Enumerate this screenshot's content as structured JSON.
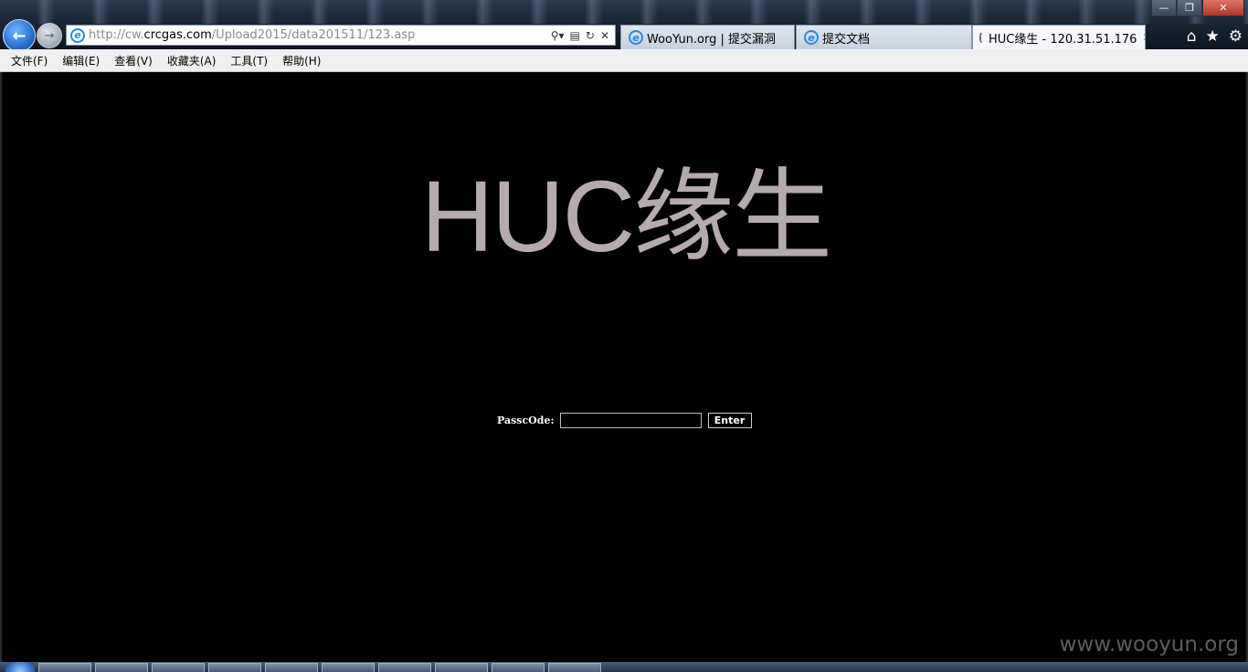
{
  "browser": {
    "address_url_prefix": "http://cw.",
    "address_url_domain": "crcgas.com",
    "address_url_path": "/Upload2015/data201511/123.asp",
    "tabs": [
      {
        "label": "WooYun.org | 提交漏洞",
        "icon": "ie-icon",
        "active": false
      },
      {
        "label": "提交文档",
        "icon": "ie-icon",
        "active": false
      },
      {
        "label": "HUC缘生 - 120.31.51.176",
        "icon": "loading-icon",
        "active": true
      }
    ],
    "menu": [
      "文件(F)",
      "编辑(E)",
      "查看(V)",
      "收藏夹(A)",
      "工具(T)",
      "帮助(H)"
    ]
  },
  "page": {
    "title": "HUC缘生",
    "pass_label": "PasscOde:",
    "pass_value": "",
    "enter_label": "Enter",
    "watermark": "www.wooyun.org"
  },
  "colors": {
    "background": "#000000",
    "title": "#b4aab0",
    "watermark": "#5d5d5d"
  }
}
